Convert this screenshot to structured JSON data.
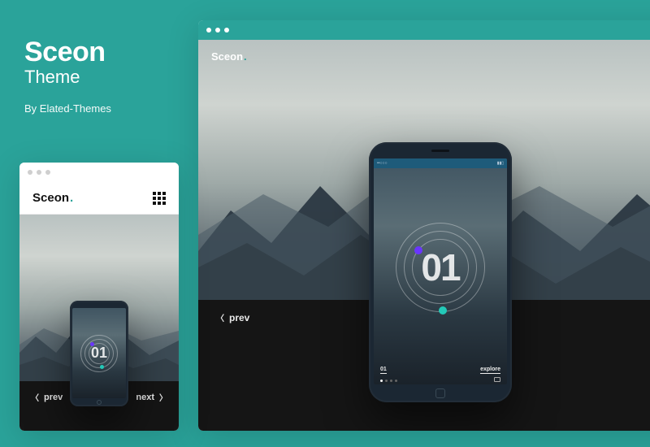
{
  "title": {
    "name": "Sceon",
    "sub": "Theme",
    "author": "By Elated-Themes"
  },
  "logo": {
    "text": "Sceon",
    "dot": "."
  },
  "nav": {
    "prev": "prev",
    "next": "next"
  },
  "phone": {
    "number": "01",
    "slide_index": "01",
    "explore": "explore",
    "status_left": "••○○○",
    "status_right": "▮▮▯"
  },
  "colors": {
    "accent": "#2aa39a",
    "fab": "#ff1f62"
  },
  "icons": {
    "menu": "grid-icon",
    "prev": "chevron-left-icon",
    "next": "chevron-right-icon",
    "settings": "gear-icon",
    "cart": "cart-icon",
    "camera": "camera-icon"
  }
}
